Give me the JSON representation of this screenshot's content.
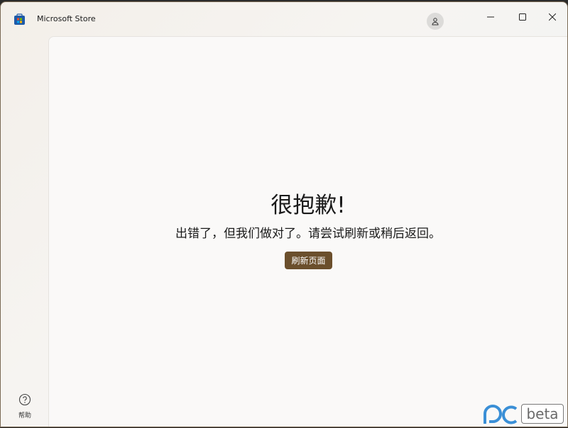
{
  "window": {
    "title": "Microsoft Store"
  },
  "icons": {
    "app": "microsoft-store-icon",
    "account": "person-icon",
    "minimize": "minimize-icon",
    "maximize": "maximize-icon",
    "close": "close-icon",
    "help": "question-circle-icon"
  },
  "sidebar": {
    "help_label": "帮助"
  },
  "error": {
    "title": "很抱歉!",
    "message": "出错了，但我们做对了。请尝试刷新或稍后返回。",
    "refresh_label": "刷新页面"
  },
  "watermark": {
    "text": "beta"
  },
  "colors": {
    "accent": "#6b4f2c",
    "logo_blue": "#3a8fd6"
  }
}
